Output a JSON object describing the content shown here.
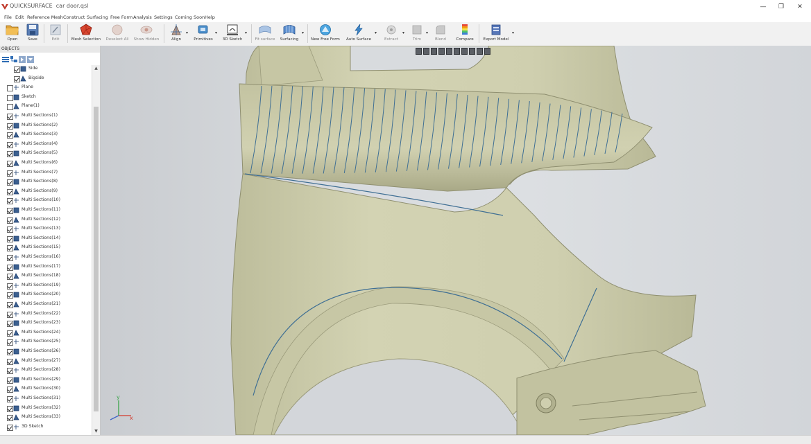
{
  "window": {
    "app_name": "QUICKSURFACE",
    "document": "car door.qsl",
    "minimize_glyph": "—",
    "maximize_glyph": "❐",
    "close_glyph": "✕"
  },
  "menu": [
    "File",
    "Edit",
    "Reference Mesh",
    "Construct",
    "Surfacing",
    "Free Form",
    "Analysis",
    "Settings",
    "Coming Soon",
    "Help"
  ],
  "toolbar": {
    "open": "Open",
    "save": "Save",
    "edit": "Edit",
    "mesh_selection": "Mesh Selection",
    "deselect_all": "Deselect All",
    "show_hidden": "Show Hidden",
    "align": "Align",
    "primitives": "Primitives",
    "sketch_3d": "3D Sketch",
    "fit_surface": "Fit surface",
    "surfacing": "Surfacing",
    "new_free_form": "New Free Form",
    "auto_surface": "Auto Surface",
    "extract": "Extract",
    "trim": "Trim",
    "blend": "Blend",
    "compare": "Compare",
    "export_model": "Export Model",
    "caret": "▾"
  },
  "panel": {
    "title": "OBJECTS",
    "scroll_up": "▲",
    "scroll_down": "▼",
    "tree": [
      {
        "label": "Side",
        "checked": true,
        "indent": 1
      },
      {
        "label": "Bigside",
        "checked": true,
        "indent": 1
      },
      {
        "label": "Plane",
        "checked": false,
        "indent": 0
      },
      {
        "label": "Sketch",
        "checked": false,
        "indent": 0
      },
      {
        "label": "Plane(1)",
        "checked": false,
        "indent": 0
      },
      {
        "label": "Multi Sections(1)",
        "checked": true,
        "indent": 0
      },
      {
        "label": "Multi Sections(2)",
        "checked": true,
        "indent": 0
      },
      {
        "label": "Multi Sections(3)",
        "checked": true,
        "indent": 0
      },
      {
        "label": "Multi Sections(4)",
        "checked": true,
        "indent": 0
      },
      {
        "label": "Multi Sections(5)",
        "checked": true,
        "indent": 0
      },
      {
        "label": "Multi Sections(6)",
        "checked": true,
        "indent": 0
      },
      {
        "label": "Multi Sections(7)",
        "checked": true,
        "indent": 0
      },
      {
        "label": "Multi Sections(8)",
        "checked": true,
        "indent": 0
      },
      {
        "label": "Multi Sections(9)",
        "checked": true,
        "indent": 0
      },
      {
        "label": "Multi Sections(10)",
        "checked": true,
        "indent": 0
      },
      {
        "label": "Multi Sections(11)",
        "checked": true,
        "indent": 0
      },
      {
        "label": "Multi Sections(12)",
        "checked": true,
        "indent": 0
      },
      {
        "label": "Multi Sections(13)",
        "checked": true,
        "indent": 0
      },
      {
        "label": "Multi Sections(14)",
        "checked": true,
        "indent": 0
      },
      {
        "label": "Multi Sections(15)",
        "checked": true,
        "indent": 0
      },
      {
        "label": "Multi Sections(16)",
        "checked": true,
        "indent": 0
      },
      {
        "label": "Multi Sections(17)",
        "checked": true,
        "indent": 0
      },
      {
        "label": "Multi Sections(18)",
        "checked": true,
        "indent": 0
      },
      {
        "label": "Multi Sections(19)",
        "checked": true,
        "indent": 0
      },
      {
        "label": "Multi Sections(20)",
        "checked": true,
        "indent": 0
      },
      {
        "label": "Multi Sections(21)",
        "checked": true,
        "indent": 0
      },
      {
        "label": "Multi Sections(22)",
        "checked": true,
        "indent": 0
      },
      {
        "label": "Multi Sections(23)",
        "checked": true,
        "indent": 0
      },
      {
        "label": "Multi Sections(24)",
        "checked": true,
        "indent": 0
      },
      {
        "label": "Multi Sections(25)",
        "checked": true,
        "indent": 0
      },
      {
        "label": "Multi Sections(26)",
        "checked": true,
        "indent": 0
      },
      {
        "label": "Multi Sections(27)",
        "checked": true,
        "indent": 0
      },
      {
        "label": "Multi Sections(28)",
        "checked": true,
        "indent": 0
      },
      {
        "label": "Multi Sections(29)",
        "checked": true,
        "indent": 0
      },
      {
        "label": "Multi Sections(30)",
        "checked": true,
        "indent": 0
      },
      {
        "label": "Multi Sections(31)",
        "checked": true,
        "indent": 0
      },
      {
        "label": "Multi Sections(32)",
        "checked": true,
        "indent": 0
      },
      {
        "label": "Multi Sections(33)",
        "checked": true,
        "indent": 0
      },
      {
        "label": "3D Sketch",
        "checked": true,
        "indent": 0
      }
    ]
  },
  "viewport": {
    "axis_y": "y",
    "axis_x": "x",
    "surface_color": "#c9c9a9",
    "curve_color": "#3f6f94"
  },
  "colors": {
    "toolbar_bg": "#f1f1f1",
    "viewport_bg": "#d6d9dc"
  }
}
